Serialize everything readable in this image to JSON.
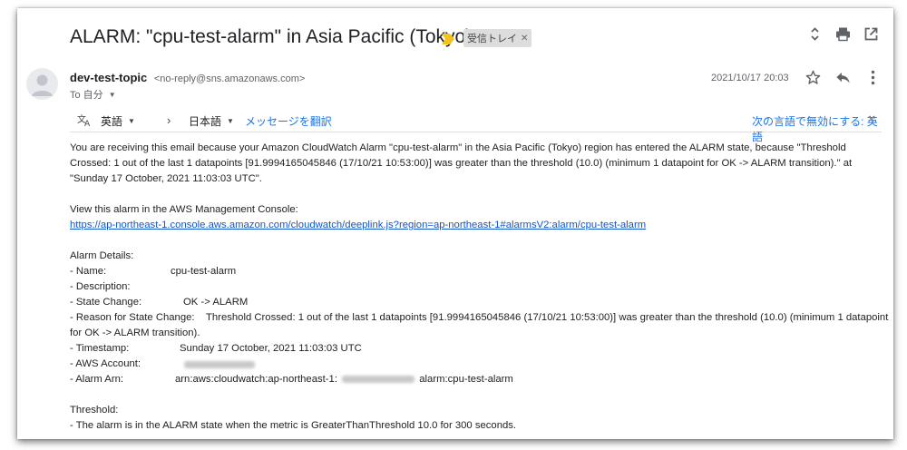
{
  "subject": "ALARM: \"cpu-test-alarm\" in Asia Pacific (Tokyo)",
  "label_chip": "受信トレイ",
  "sender": {
    "name": "dev-test-topic",
    "email": "<no-reply@sns.amazonaws.com>",
    "to": "To 自分"
  },
  "date": "2021/10/17 20:03",
  "translate": {
    "source_lang": "英語",
    "target_lang": "日本語",
    "translate_link": "メッセージを翻訳",
    "disable_link": "次の言語で無効にする: 英語"
  },
  "body": {
    "intro": "You are receiving this email because your Amazon CloudWatch Alarm \"cpu-test-alarm\" in the Asia Pacific (Tokyo) region has entered the ALARM state, because \"Threshold Crossed: 1 out of the last 1 datapoints [91.9994165045846 (17/10/21 10:53:00)] was greater than the threshold (10.0) (minimum 1 datapoint for OK -> ALARM transition).\" at \"Sunday 17 October, 2021 11:03:03 UTC\".",
    "view_text": "View this alarm in the AWS Management Console:",
    "console_link": "https://ap-northeast-1.console.aws.amazon.com/cloudwatch/deeplink.js?region=ap-northeast-1#alarmsV2:alarm/cpu-test-alarm",
    "details_header": "Alarm Details:",
    "details": {
      "name_k": "- Name:",
      "name_v": "cpu-test-alarm",
      "desc_k": "- Description:",
      "state_k": "- State Change:",
      "state_v": "OK -> ALARM",
      "reason_k": "- Reason for State Change:",
      "reason_v1": "Threshold Crossed: 1 out of the last 1 datapoints [91.9994165045846 (17/10/21 10:53:00)] was greater than the threshold (10.0) (minimum 1 datapoint",
      "reason_v2": "for OK -> ALARM transition).",
      "ts_k": "- Timestamp:",
      "ts_v": "Sunday 17 October, 2021 11:03:03 UTC",
      "acct_k": "- AWS Account:",
      "arn_k": "- Alarm Arn:",
      "arn_prefix": "arn:aws:cloudwatch:ap-northeast-1:",
      "arn_suffix": "alarm:cpu-test-alarm"
    },
    "threshold_header": "Threshold:",
    "threshold_line": "- The alarm is in the ALARM state when the metric is GreaterThanThreshold 10.0 for 300 seconds."
  },
  "colors": {
    "link": "#1155cc",
    "accent": "#1a73e8",
    "importance": "#f2c318"
  },
  "icons": [
    "important-marker-icon",
    "close-icon",
    "expand-icon",
    "print-icon",
    "open-new-window-icon",
    "avatar-icon",
    "star-icon",
    "reply-icon",
    "more-vert-icon",
    "translate-icon",
    "chevron-right-icon"
  ]
}
